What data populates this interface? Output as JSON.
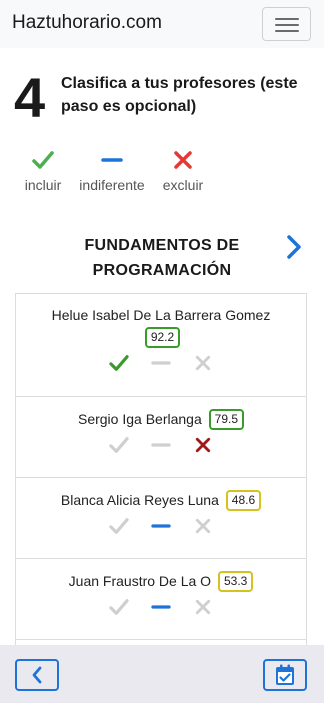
{
  "navbar": {
    "brand": "Haztuhorario.com",
    "menu_icon": "hamburger-icon"
  },
  "step": {
    "number": "4",
    "text": "Clasifica a tus profesores (este paso es opcional)"
  },
  "legend": [
    {
      "label": "incluir",
      "icon": "check-icon",
      "color": "#4caf50"
    },
    {
      "label": "indiferente",
      "icon": "dash-icon",
      "color": "#1e73d8"
    },
    {
      "label": "excluir",
      "icon": "x-icon",
      "color": "#e53935"
    }
  ],
  "course": {
    "title": "FUNDAMENTOS DE PROGRAMACIÓN",
    "next_icon": "chevron-right-icon"
  },
  "professors": [
    {
      "name": "Helue Isabel De La Barrera Gomez",
      "score": "92.2",
      "score_color": "#3a9a2b",
      "selected": "incluir"
    },
    {
      "name": "Sergio Iga Berlanga",
      "score": "79.5",
      "score_color": "#3a9a2b",
      "selected": "excluir"
    },
    {
      "name": "Blanca Alicia Reyes Luna",
      "score": "48.6",
      "score_color": "#d4c21f",
      "selected": "indiferente"
    },
    {
      "name": "Juan Fraustro De La O",
      "score": "53.3",
      "score_color": "#d4c21f",
      "selected": "indiferente"
    }
  ],
  "colors": {
    "accent": "#1e73d8",
    "include": "#3a9a2b",
    "exclude_active": "#a01818",
    "inactive": "#cfcfcf"
  },
  "bottom": {
    "back_icon": "chevron-left-icon",
    "schedule_icon": "calendar-check-icon"
  }
}
